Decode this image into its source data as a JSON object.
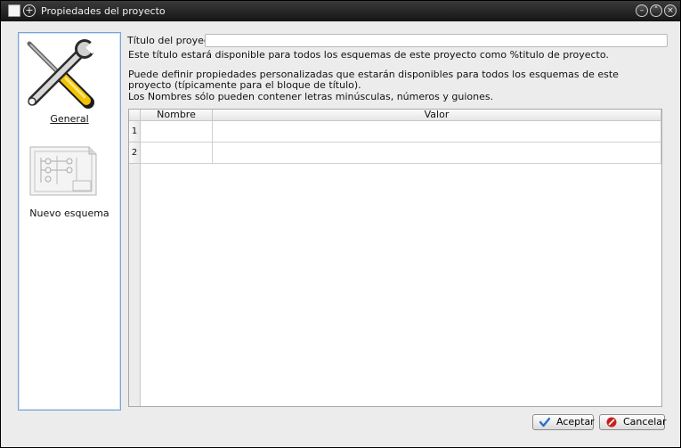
{
  "window": {
    "title": "Propiedades del proyecto",
    "controls": [
      "minimize",
      "maximize",
      "close"
    ]
  },
  "sidebar": {
    "items": [
      {
        "label": "General",
        "icon": "tools-icon",
        "selected": true
      },
      {
        "label": "Nuevo esquema",
        "icon": "schema-icon",
        "selected": false
      }
    ]
  },
  "form": {
    "title_label": "Título del proyecto:",
    "title_value": "",
    "info_text": "Este título estará disponible para todos los esquemas de este proyecto como %titulo de proyecto.",
    "custom_props_text": "Puede definir propiedades personalizadas que estarán disponibles para todos los esquemas de este proyecto (típicamente para el bloque de título).",
    "names_rule_text": "Los Nombres sólo pueden contener letras minúsculas, números y guiones."
  },
  "table": {
    "columns": [
      "Nombre",
      "Valor"
    ],
    "rows": [
      {
        "index": "1",
        "name": "",
        "value": ""
      },
      {
        "index": "2",
        "name": "",
        "value": ""
      }
    ]
  },
  "buttons": {
    "accept": "Aceptar",
    "cancel": "Cancelar"
  },
  "colors": {
    "accent": "#7aa6d6",
    "accept_icon": "#2a6fc9",
    "cancel_icon": "#c8201e"
  }
}
